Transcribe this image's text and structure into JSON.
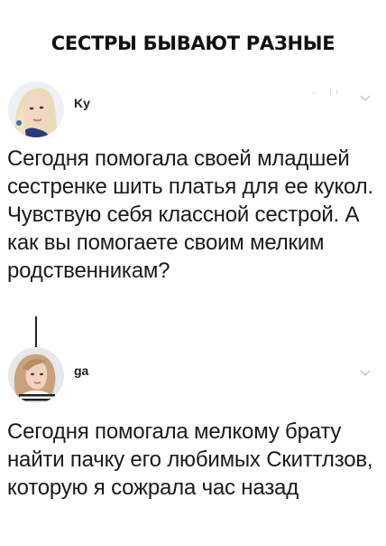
{
  "headline": "СЕСТРЫ БЫВАЮТ РАЗНЫЕ",
  "tweets": [
    {
      "username": "Ky",
      "text": "Сегодня помогала своей младшей сестренке шить платья для ее кукол. Чувствую себя классной сестрой. А как вы помогаете своим мелким родственникам?",
      "avatar": "blonde-woman-avatar",
      "menu_icon": "chevron-down-icon"
    },
    {
      "username": "ga",
      "text": "Сегодня помогала мелкому брату найти пачку его любимых Скиттлзов, которую я сожрала час назад",
      "avatar": "woman-striped-shirt-avatar",
      "menu_icon": "chevron-down-icon"
    }
  ],
  "colors": {
    "text": "#1a1a1a",
    "chevron": "#b8c2cc",
    "thread_line": "#222222"
  }
}
